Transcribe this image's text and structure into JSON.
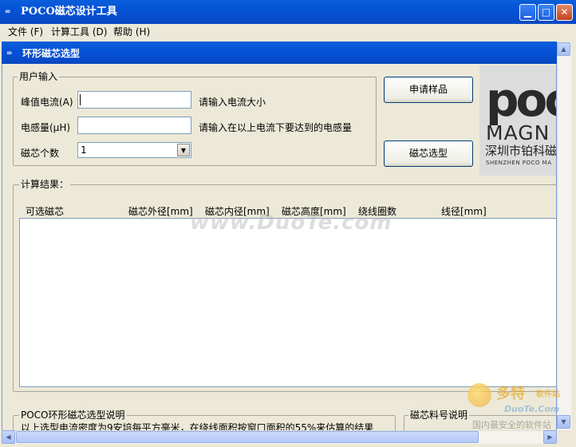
{
  "window": {
    "title": "POCO磁芯设计工具",
    "app_icon": "∞"
  },
  "menu": [
    {
      "label": "文件 (F)"
    },
    {
      "label": "计算工具 (D)"
    },
    {
      "label": "帮助 (H)"
    }
  ],
  "inner": {
    "title": "环形磁芯选型",
    "icon": "∞"
  },
  "input_group": {
    "label": "用户输入",
    "peak_current_label": "峰值电流(A)",
    "peak_current_value": "",
    "peak_current_hint": "请输入电流大小",
    "inductance_label": "电感量(µH)",
    "inductance_value": "",
    "inductance_hint": "请输入在以上电流下要达到的电感量",
    "core_count_label": "磁芯个数",
    "core_count_value": "1"
  },
  "buttons": {
    "sample": "申请样品",
    "select": "磁芯选型"
  },
  "logo": {
    "mark": "poc",
    "brand": "MAGN",
    "cn": "深圳市铂科磁",
    "en": "SHENZHEN POCO MA"
  },
  "results": {
    "label": "计算结果：",
    "columns": [
      "可选磁芯",
      "磁芯外径[mm]",
      "磁芯内径[mm]",
      "磁芯高度[mm]",
      "绕线圈数",
      "线径[mm]"
    ]
  },
  "bottom": {
    "desc_label": "POCO环形磁芯选型说明",
    "desc_text": "以上选型电流密度为9安培每平方毫米，在绕线面积按窗口面积的55%来估算的结果",
    "material_label": "磁芯料号说明"
  },
  "watermark": {
    "center": "www.DuoTe.com",
    "corner_cn": "多特",
    "corner_sub": "软件站",
    "corner_en": "DuoTe.Com",
    "corner_slogan": "国内最安全的软件站"
  },
  "icons": {
    "minimize": "minimize-icon",
    "maximize": "maximize-icon",
    "close": "close-icon",
    "combo": "chevron-down-icon",
    "scroll_up": "arrow-up-icon",
    "scroll_down": "arrow-down-icon",
    "scroll_left": "arrow-left-icon",
    "scroll_right": "arrow-right-icon"
  }
}
